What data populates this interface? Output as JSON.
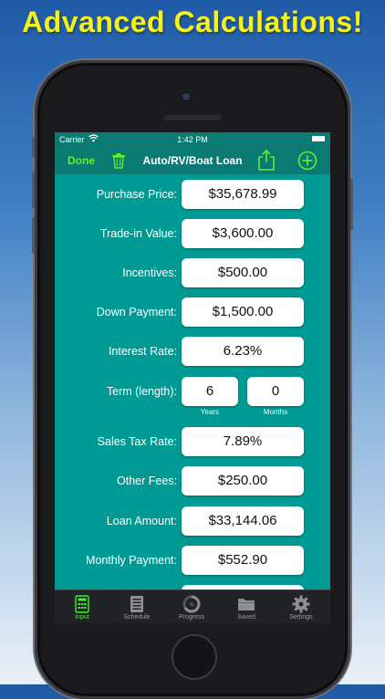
{
  "headline": "Advanced Calculations!",
  "status": {
    "carrier": "Carrier",
    "time": "1:42 PM"
  },
  "nav": {
    "done_label": "Done",
    "title": "Auto/RV/Boat Loan"
  },
  "rows": {
    "purchase_price": {
      "label": "Purchase Price:",
      "value": "$35,678.99"
    },
    "trade_in": {
      "label": "Trade-in Value:",
      "value": "$3,600.00"
    },
    "incentives": {
      "label": "Incentives:",
      "value": "$500.00"
    },
    "down_payment": {
      "label": "Down Payment:",
      "value": "$1,500.00"
    },
    "interest_rate": {
      "label": "Interest Rate:",
      "value": "6.23%"
    },
    "term": {
      "label": "Term (length):",
      "years": "6",
      "months": "0",
      "years_label": "Years",
      "months_label": "Months"
    },
    "sales_tax": {
      "label": "Sales Tax Rate:",
      "value": "7.89%"
    },
    "other_fees": {
      "label": "Other Fees:",
      "value": "$250.00"
    },
    "loan_amount": {
      "label": "Loan Amount:",
      "value": "$33,144.06"
    },
    "monthly_payment": {
      "label": "Monthly Payment:",
      "value": "$552.90"
    }
  },
  "tabs": [
    {
      "label": "Input",
      "icon": "calculator-icon"
    },
    {
      "label": "Schedule",
      "icon": "schedule-icon"
    },
    {
      "label": "Progress",
      "icon": "progress-icon"
    },
    {
      "label": "Saved",
      "icon": "folder-icon"
    },
    {
      "label": "Settings",
      "icon": "gear-icon"
    }
  ],
  "colors": {
    "screen_bg": "#009a94",
    "bar_bg": "#0b7a73",
    "accent_green": "#3bf22e",
    "headline_yellow": "#f5f11a"
  }
}
